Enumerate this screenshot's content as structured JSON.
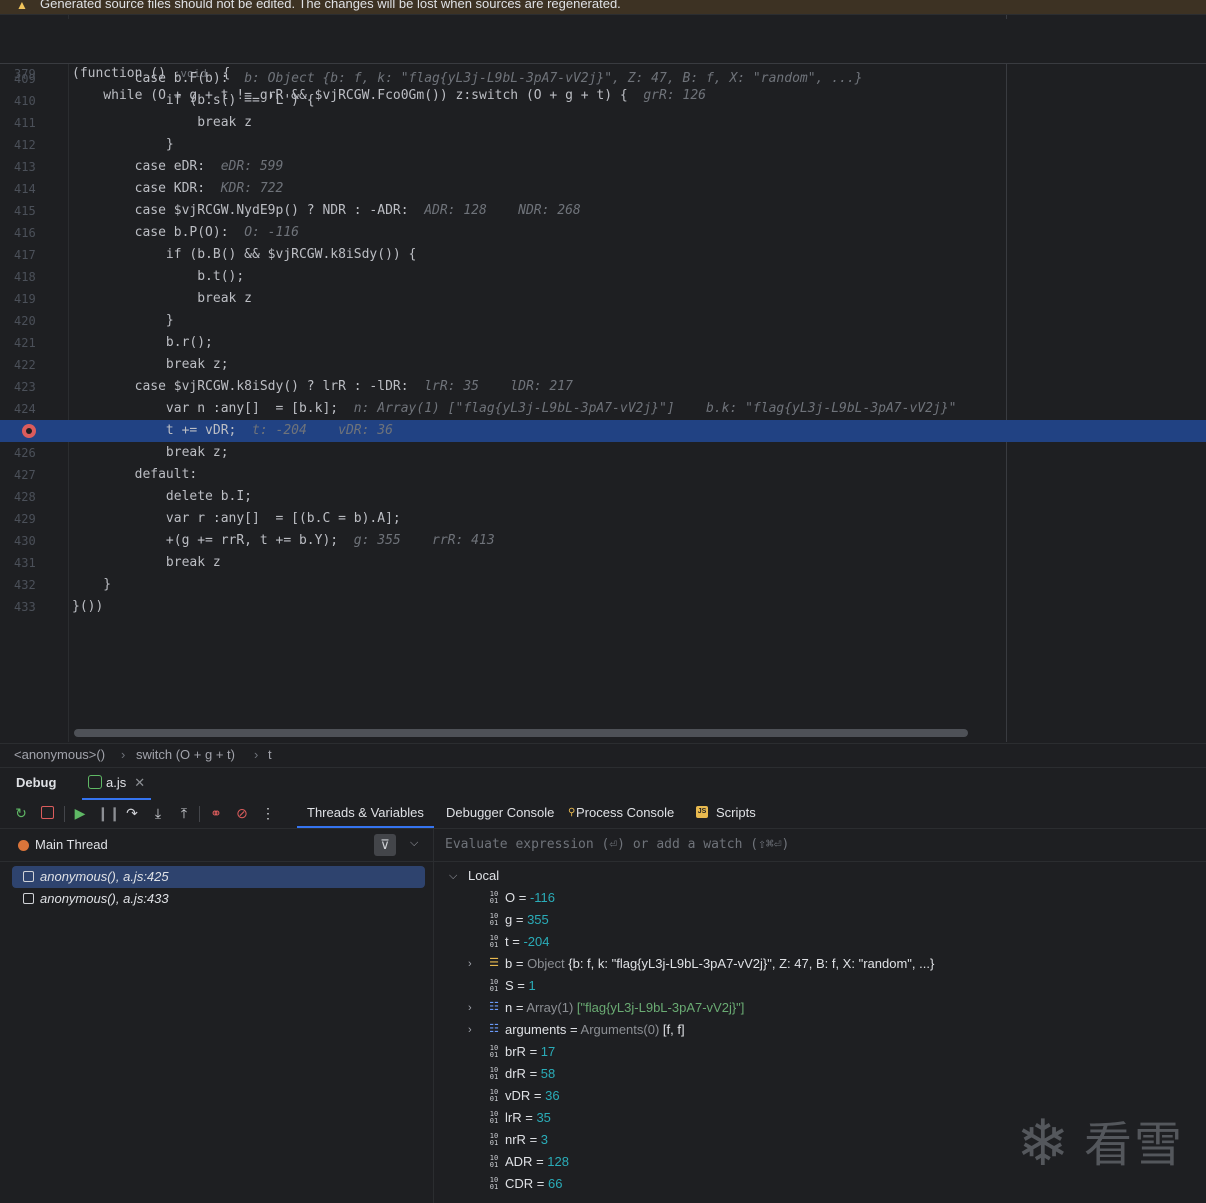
{
  "banner": {
    "text": "Generated source files should not be edited. The changes will be lost when sources are regenerated."
  },
  "editor": {
    "sticky": [
      {
        "num": "350",
        "code": "(function () ",
        "hint": ":void",
        "rest": "  {",
        "tail": ""
      },
      {
        "num": "379",
        "code": "    while (O + g + t != grR && $vjRCGW.Fco0Gm()) z:switch (O + g + t) {",
        "hint": "",
        "rest": "",
        "tail": "  grR: 126"
      }
    ],
    "lines": [
      {
        "num": "409",
        "code": "        case b.F(b):",
        "tail": "  b: Object {b: f, k: \"flag{yL3j-L9bL-3pA7-vV2j}\", Z: 47, B: f, X: \"random\", ...}"
      },
      {
        "num": "410",
        "code": "            if (b.s() == 'L') {",
        "tail": ""
      },
      {
        "num": "411",
        "code": "                break z",
        "tail": ""
      },
      {
        "num": "412",
        "code": "            }",
        "tail": ""
      },
      {
        "num": "413",
        "code": "        case eDR:",
        "tail": "  eDR: 599"
      },
      {
        "num": "414",
        "code": "        case KDR:",
        "tail": "  KDR: 722"
      },
      {
        "num": "415",
        "code": "        case $vjRCGW.NydE9p() ? NDR : -ADR:",
        "tail": "  ADR: 128    NDR: 268"
      },
      {
        "num": "416",
        "code": "        case b.P(O):",
        "tail": "  O: -116"
      },
      {
        "num": "417",
        "code": "            if (b.B() && $vjRCGW.k8iSdy()) {",
        "tail": ""
      },
      {
        "num": "418",
        "code": "                b.t();",
        "tail": ""
      },
      {
        "num": "419",
        "code": "                break z",
        "tail": ""
      },
      {
        "num": "420",
        "code": "            }",
        "tail": ""
      },
      {
        "num": "421",
        "code": "            b.r();",
        "tail": ""
      },
      {
        "num": "422",
        "code": "            break z;",
        "tail": ""
      },
      {
        "num": "423",
        "code": "        case $vjRCGW.k8iSdy() ? lrR : -lDR:",
        "tail": "  lrR: 35    lDR: 217"
      },
      {
        "num": "424",
        "code": "            var n :any[]  = [b.k];",
        "tail": "  n: Array(1) [\"flag{yL3j-L9bL-3pA7-vV2j}\"]    b.k: \"flag{yL3j-L9bL-3pA7-vV2j}\""
      },
      {
        "num": "425",
        "code": "            t += vDR;",
        "tail": "  t: -204    vDR: 36",
        "active": true
      },
      {
        "num": "426",
        "code": "            break z;",
        "tail": ""
      },
      {
        "num": "427",
        "code": "        default:",
        "tail": ""
      },
      {
        "num": "428",
        "code": "            delete b.I;",
        "tail": ""
      },
      {
        "num": "429",
        "code": "            var r :any[]  = [(b.C = b).A];",
        "tail": ""
      },
      {
        "num": "430",
        "code": "            +(g += rrR, t += b.Y);",
        "tail": "  g: 355    rrR: 413"
      },
      {
        "num": "431",
        "code": "            break z",
        "tail": ""
      },
      {
        "num": "432",
        "code": "    }",
        "tail": ""
      },
      {
        "num": "433",
        "code": "}())",
        "tail": ""
      }
    ]
  },
  "breadcrumb": {
    "items": [
      "<anonymous>()",
      "switch (O + g + t)",
      "t"
    ]
  },
  "debug": {
    "title": "Debug",
    "file_tab": "a.js",
    "tabs": [
      "Threads & Variables",
      "Debugger Console",
      "Process Console",
      "Scripts"
    ],
    "thread": "Main Thread",
    "frames": [
      "anonymous(), a.js:425",
      "anonymous(), a.js:433"
    ],
    "eval_placeholder": "Evaluate expression (⏎) or add a watch (⇧⌘⏎)",
    "local_label": "Local",
    "variables": [
      {
        "name": "O",
        "sep": " = ",
        "type": "",
        "value": "-116",
        "vclass": "num",
        "expand": false,
        "icon": "primitive-icon"
      },
      {
        "name": "g",
        "sep": " = ",
        "type": "",
        "value": "355",
        "vclass": "num",
        "expand": false,
        "icon": "primitive-icon"
      },
      {
        "name": "t",
        "sep": " = ",
        "type": "",
        "value": "-204",
        "vclass": "num",
        "expand": false,
        "icon": "primitive-icon"
      },
      {
        "name": "b",
        "sep": " = ",
        "type": "Object ",
        "value": "{b: f, k: \"flag{yL3j-L9bL-3pA7-vV2j}\", Z: 47, B: f, X: \"random\", ...}",
        "vclass": "obj",
        "expand": true,
        "icon": "object-icon"
      },
      {
        "name": "S",
        "sep": " = ",
        "type": "",
        "value": "1",
        "vclass": "num",
        "expand": false,
        "icon": "primitive-icon"
      },
      {
        "name": "n",
        "sep": " = ",
        "type": "Array(1) ",
        "value": "[\"flag{yL3j-L9bL-3pA7-vV2j}\"]",
        "vclass": "arr",
        "expand": true,
        "icon": "array-icon"
      },
      {
        "name": "arguments",
        "sep": " = ",
        "type": "Arguments(0) ",
        "value": "[f, f]",
        "vclass": "plain",
        "expand": true,
        "icon": "array-icon"
      },
      {
        "name": "brR",
        "sep": " = ",
        "type": "",
        "value": "17",
        "vclass": "num",
        "expand": false,
        "icon": "primitive-icon"
      },
      {
        "name": "drR",
        "sep": " = ",
        "type": "",
        "value": "58",
        "vclass": "num",
        "expand": false,
        "icon": "primitive-icon"
      },
      {
        "name": "vDR",
        "sep": " = ",
        "type": "",
        "value": "36",
        "vclass": "num",
        "expand": false,
        "icon": "primitive-icon"
      },
      {
        "name": "lrR",
        "sep": " = ",
        "type": "",
        "value": "35",
        "vclass": "num",
        "expand": false,
        "icon": "primitive-icon"
      },
      {
        "name": "nrR",
        "sep": " = ",
        "type": "",
        "value": "3",
        "vclass": "num",
        "expand": false,
        "icon": "primitive-icon"
      },
      {
        "name": "ADR",
        "sep": " = ",
        "type": "",
        "value": "128",
        "vclass": "num",
        "expand": false,
        "icon": "primitive-icon"
      },
      {
        "name": "CDR",
        "sep": " = ",
        "type": "",
        "value": "66",
        "vclass": "num",
        "expand": false,
        "icon": "primitive-icon"
      }
    ]
  },
  "watermark": {
    "text": "看雪"
  },
  "colors": {
    "accent": "#3574f0",
    "active_line": "#214283",
    "breakpoint": "#db5c5c",
    "number": "#2aacb8",
    "string": "#6aab73"
  }
}
